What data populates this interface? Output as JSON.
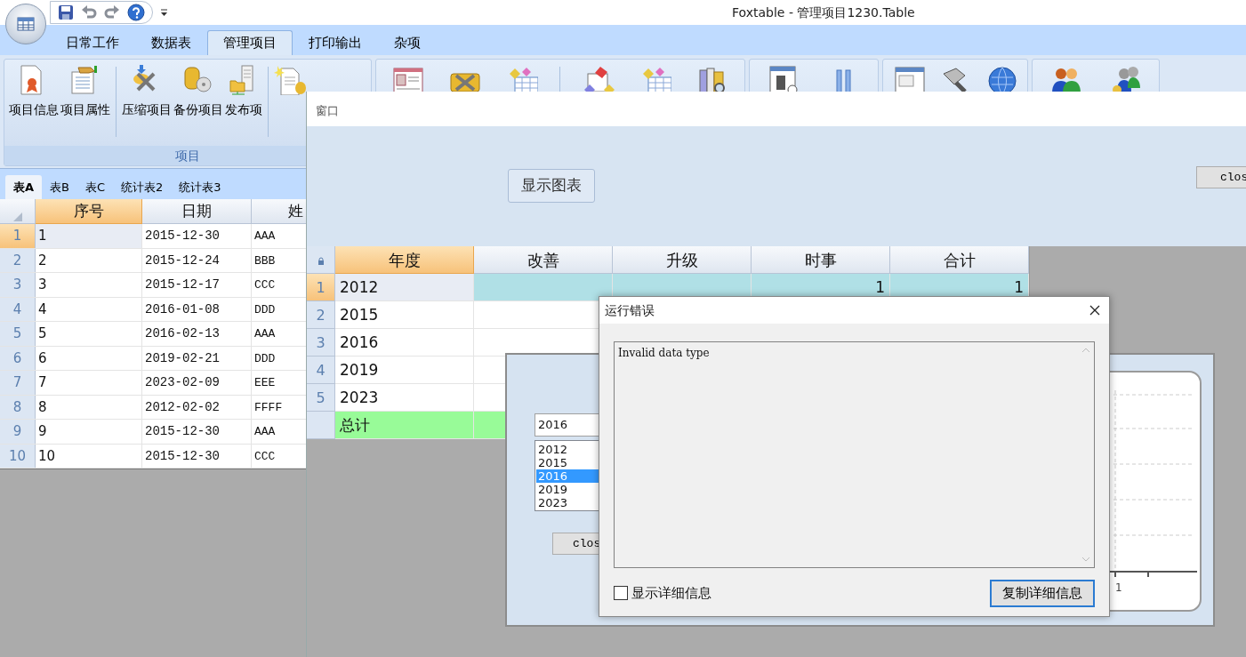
{
  "app": {
    "title": "Foxtable - 管理项目1230.Table"
  },
  "ribbon": {
    "tabs": [
      {
        "label": "日常工作",
        "selected": false
      },
      {
        "label": "数据表",
        "selected": false
      },
      {
        "label": "管理项目",
        "selected": true
      },
      {
        "label": "打印输出",
        "selected": false
      },
      {
        "label": "杂项",
        "selected": false
      }
    ],
    "group": {
      "label": "项目",
      "buttons": [
        "项目信息",
        "项目属性",
        "压缩项目",
        "备份项目",
        "发布项"
      ]
    }
  },
  "sheet_tabs": [
    {
      "label": "表A",
      "selected": true
    },
    {
      "label": "表B",
      "selected": false
    },
    {
      "label": "表C",
      "selected": false
    },
    {
      "label": "统计表2",
      "selected": false
    },
    {
      "label": "统计表3",
      "selected": false
    }
  ],
  "table": {
    "columns": [
      {
        "label": "序号",
        "selected": true
      },
      {
        "label": "日期",
        "selected": false
      },
      {
        "label": "姓",
        "selected": false
      }
    ],
    "rows": [
      {
        "num": "1",
        "cells": [
          "1",
          "2015-12-30",
          "AAA"
        ],
        "selected": true
      },
      {
        "num": "2",
        "cells": [
          "2",
          "2015-12-24",
          "BBB"
        ],
        "selected": false
      },
      {
        "num": "3",
        "cells": [
          "3",
          "2015-12-17",
          "CCC"
        ],
        "selected": false
      },
      {
        "num": "4",
        "cells": [
          "4",
          "2016-01-08",
          "DDD"
        ],
        "selected": false
      },
      {
        "num": "5",
        "cells": [
          "5",
          "2016-02-13",
          "AAA"
        ],
        "selected": false
      },
      {
        "num": "6",
        "cells": [
          "6",
          "2019-02-21",
          "DDD"
        ],
        "selected": false
      },
      {
        "num": "7",
        "cells": [
          "7",
          "2023-02-09",
          "EEE"
        ],
        "selected": false
      },
      {
        "num": "8",
        "cells": [
          "8",
          "2012-02-02",
          "FFFF"
        ],
        "selected": false
      },
      {
        "num": "9",
        "cells": [
          "9",
          "2015-12-30",
          "AAA"
        ],
        "selected": false
      },
      {
        "num": "10",
        "cells": [
          "10",
          "2015-12-30",
          "CCC"
        ],
        "selected": false
      }
    ]
  },
  "window": {
    "title": "窗口",
    "show_chart_button": "显示图表",
    "close_button": "clos",
    "grid": {
      "columns": [
        {
          "label": "年度",
          "selected": true
        },
        {
          "label": "改善",
          "selected": false
        },
        {
          "label": "升级",
          "selected": false
        },
        {
          "label": "时事",
          "selected": false
        },
        {
          "label": "合计",
          "selected": false
        }
      ],
      "rows": [
        {
          "kind": "data",
          "num": "1",
          "selected": true,
          "cells": [
            {
              "text": "2012"
            },
            {},
            {},
            {
              "text": "1"
            },
            {
              "text": "1"
            }
          ]
        },
        {
          "kind": "data",
          "num": "2",
          "selected": false,
          "cells": [
            {
              "text": "2015"
            },
            {}
          ]
        },
        {
          "kind": "data",
          "num": "3",
          "selected": false,
          "cells": [
            {
              "text": "2016"
            },
            {}
          ]
        },
        {
          "kind": "data",
          "num": "4",
          "selected": false,
          "cells": [
            {
              "text": "2019"
            },
            {}
          ]
        },
        {
          "kind": "data",
          "num": "5",
          "selected": false,
          "cells": [
            {
              "text": "2023"
            },
            {}
          ]
        },
        {
          "kind": "total",
          "selected": false,
          "cells": [
            {
              "text": "总计"
            },
            {}
          ]
        }
      ]
    }
  },
  "chart_dialog": {
    "field_value": "2016",
    "list": [
      {
        "label": "2012",
        "selected": false
      },
      {
        "label": "2015",
        "selected": false
      },
      {
        "label": "2016",
        "selected": true
      },
      {
        "label": "2019",
        "selected": false
      },
      {
        "label": "2023",
        "selected": false
      }
    ],
    "close_button": "clos",
    "axis_label": "1"
  },
  "error_dialog": {
    "title": "运行错误",
    "message": "Invalid data type",
    "show_details": {
      "label": "显示详细信息",
      "checked": false
    },
    "copy_button": "复制详细信息"
  }
}
